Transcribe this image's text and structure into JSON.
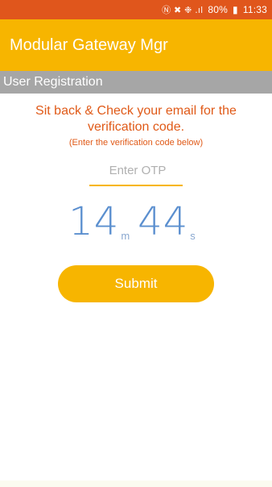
{
  "status_bar": {
    "icons": "Ⓝ ✖ ❉ .ıl",
    "battery": "80%",
    "time": "11:33"
  },
  "app_bar": {
    "title": "Modular Gateway Mgr"
  },
  "section": {
    "title": "User Registration"
  },
  "instructions": {
    "main": "Sit back & Check your email for the verification code.",
    "hint": "(Enter the verification code below)"
  },
  "otp": {
    "placeholder": "Enter OTP",
    "value": ""
  },
  "timer": {
    "minutes": "14",
    "minutes_unit": "m",
    "seconds": "44",
    "seconds_unit": "s"
  },
  "submit": {
    "label": "Submit"
  },
  "colors": {
    "status_bar": "#e0561c",
    "app_bar": "#f7b500",
    "section_bar": "#a6a6a6",
    "instruction_text": "#e05a18",
    "timer_text": "#5b8fcf",
    "button": "#f7b500"
  }
}
